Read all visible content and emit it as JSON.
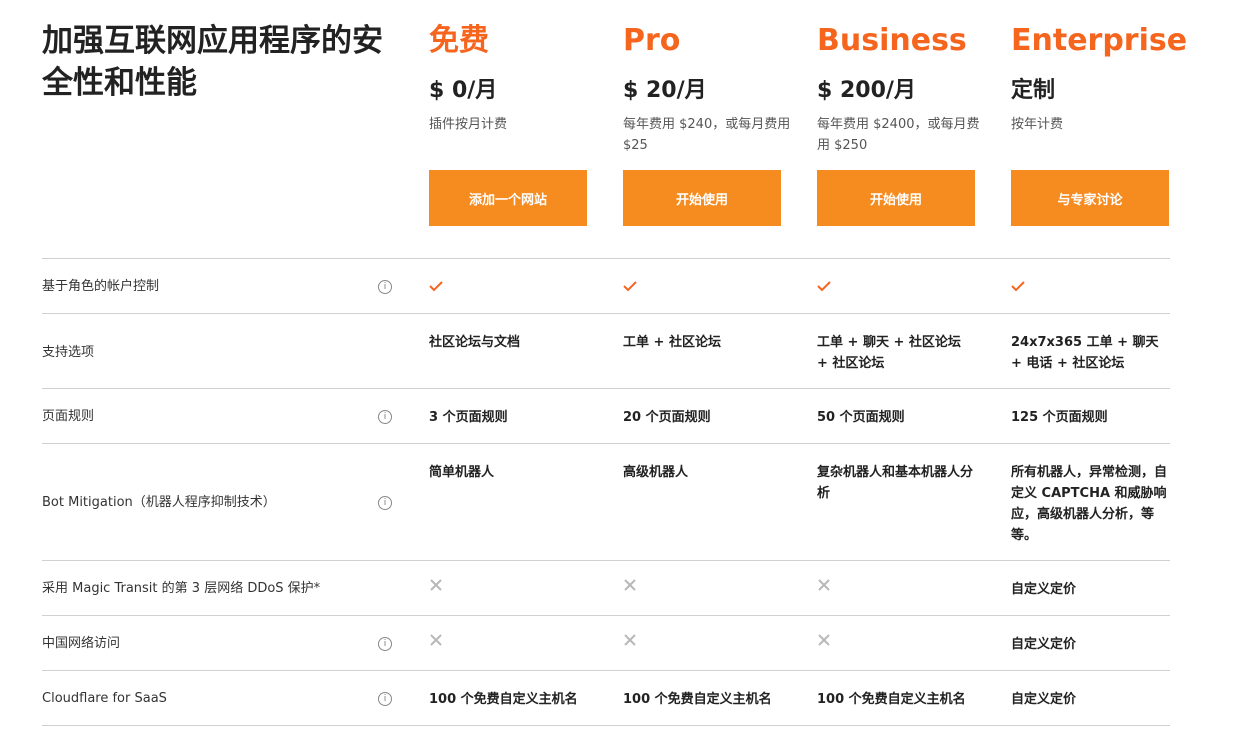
{
  "page_title": "加强互联网应用程序的安全性和性能",
  "plans": [
    {
      "name": "免费",
      "price": "$ 0/月",
      "note": "插件按月计费",
      "button": "添加一个网站"
    },
    {
      "name": "Pro",
      "price": "$ 20/月",
      "note": "每年费用 $240，或每月费用 $25",
      "button": "开始使用"
    },
    {
      "name": "Business",
      "price": "$ 200/月",
      "note": "每年费用 $2400，或每月费用 $250",
      "button": "开始使用"
    },
    {
      "name": "Enterprise",
      "price": "定制",
      "note": "按年计费",
      "button": "与专家讨论"
    }
  ],
  "rows": [
    {
      "feature": "基于角色的帐户控制",
      "info": true,
      "cells": [
        "check",
        "check",
        "check",
        "check"
      ]
    },
    {
      "feature": "支持选项",
      "info": false,
      "cells": [
        "社区论坛与文档",
        "工单 + 社区论坛",
        "工单 + 聊天 + 社区论坛 + 社区论坛",
        "24x7x365 工单 + 聊天 + 电话 + 社区论坛"
      ]
    },
    {
      "feature": "页面规则",
      "info": true,
      "cells": [
        "3 个页面规则",
        "20 个页面规则",
        "50 个页面规则",
        "125 个页面规则"
      ]
    },
    {
      "feature": "Bot Mitigation（机器人程序抑制技术）",
      "info": true,
      "cells": [
        "简单机器人",
        "高级机器人",
        "复杂机器人和基本机器人分析",
        "所有机器人，异常检测，自定义 CAPTCHA 和威胁响应，高级机器人分析，等等。"
      ]
    },
    {
      "feature": "采用 Magic Transit 的第 3 层网络 DDoS 保护*",
      "info": false,
      "cells": [
        "cross",
        "cross",
        "cross",
        "自定义定价"
      ]
    },
    {
      "feature": "中国网络访问",
      "info": true,
      "cells": [
        "cross",
        "cross",
        "cross",
        "自定义定价"
      ]
    },
    {
      "feature": "Cloudflare for SaaS",
      "info": true,
      "cells": [
        "100 个免费自定义主机名",
        "100 个免费自定义主机名",
        "100 个免费自定义主机名",
        "自定义定价"
      ]
    }
  ],
  "info_glyph": "ⓘ",
  "colors": {
    "accent": "#f6651e",
    "button": "#f68b1f",
    "check": "#f6651e",
    "cross": "#b8b8b8"
  }
}
